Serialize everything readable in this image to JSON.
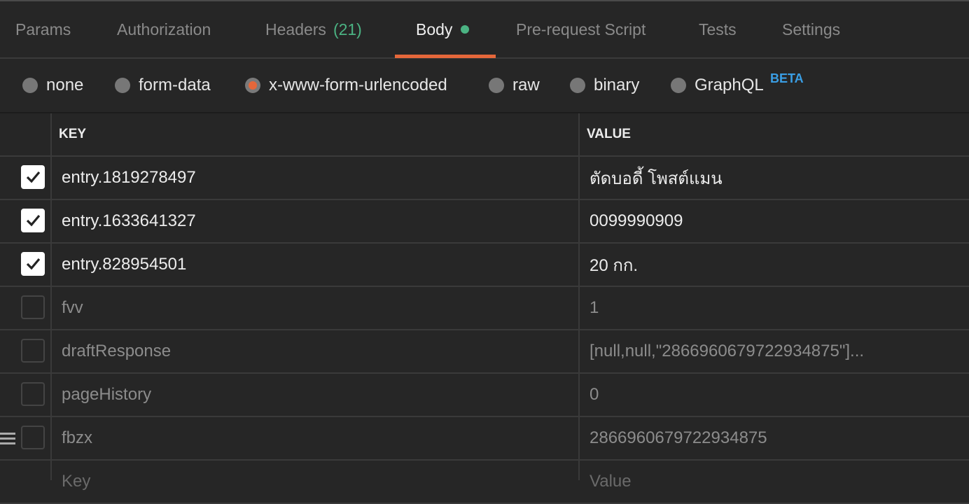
{
  "tabs": [
    {
      "label": "Params"
    },
    {
      "label": "Authorization"
    },
    {
      "label": "Headers",
      "count": "(21)"
    },
    {
      "label": "Body",
      "active": true
    },
    {
      "label": "Pre-request Script"
    },
    {
      "label": "Tests"
    },
    {
      "label": "Settings"
    }
  ],
  "body_types": {
    "options": [
      "none",
      "form-data",
      "x-www-form-urlencoded",
      "raw",
      "binary",
      "GraphQL"
    ],
    "selected": "x-www-form-urlencoded",
    "beta_label": "BETA"
  },
  "table": {
    "headers": {
      "key": "KEY",
      "value": "VALUE"
    },
    "rows": [
      {
        "checked": true,
        "key": "entry.1819278497",
        "value": "ตัดบอดี้ โพสต์แมน"
      },
      {
        "checked": true,
        "key": "entry.1633641327",
        "value": "0099990909"
      },
      {
        "checked": true,
        "key": "entry.828954501",
        "value": "20 กก."
      },
      {
        "checked": false,
        "key": "fvv",
        "value": "1"
      },
      {
        "checked": false,
        "key": "draftResponse",
        "value": "[null,null,\"2866960679722934875\"]..."
      },
      {
        "checked": false,
        "key": "pageHistory",
        "value": "0"
      },
      {
        "checked": false,
        "key": "fbzx",
        "value": "2866960679722934875"
      }
    ],
    "new_row": {
      "key_placeholder": "Key",
      "value_placeholder": "Value"
    }
  },
  "colors": {
    "accent": "#e5673a",
    "green": "#4bb383",
    "beta": "#3a9ee4",
    "background": "#262626"
  }
}
